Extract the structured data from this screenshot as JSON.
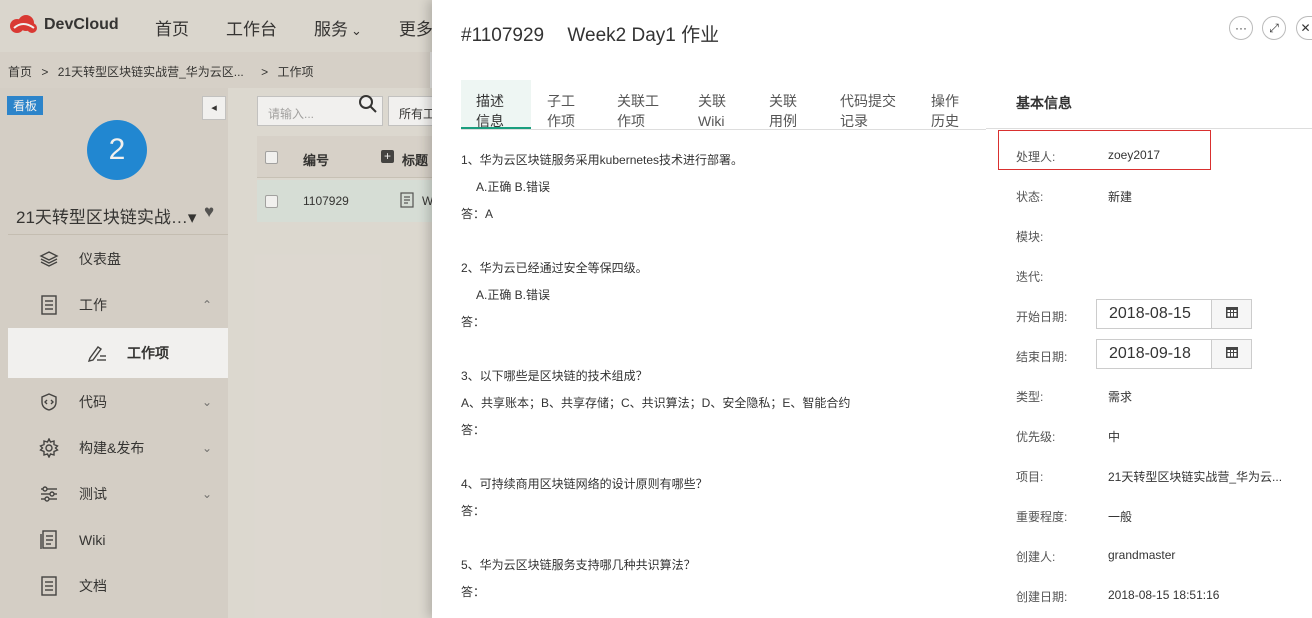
{
  "app": {
    "brand": "DevCloud",
    "brand_color": "#e53935",
    "top_nav": [
      "首页",
      "工作台",
      "服务",
      "更多"
    ],
    "dropdown_chevron": "⌄"
  },
  "breadcrumb": [
    "首页",
    ">",
    "21天转型区块链实战营_华为云区...",
    ">",
    "工作项"
  ],
  "sidebar": {
    "board_badge": "看板",
    "collapse_glyph": "◂",
    "project_number": "2",
    "project_name": "21天转型区块链实战…▾",
    "items": [
      {
        "label": "仪表盘",
        "icon": "layers-icon"
      },
      {
        "label": "工作",
        "icon": "list-doc-icon",
        "chevron": "⌃"
      },
      {
        "label": "工作项",
        "icon": "edit-list-icon"
      },
      {
        "label": "代码",
        "icon": "shield-code-icon",
        "chevron": "⌄"
      },
      {
        "label": "构建&发布",
        "icon": "gear-icon",
        "chevron": "⌄"
      },
      {
        "label": "测试",
        "icon": "sliders-icon",
        "chevron": "⌄"
      },
      {
        "label": "Wiki",
        "icon": "wiki-icon"
      },
      {
        "label": "文档",
        "icon": "doc-icon"
      }
    ]
  },
  "list": {
    "search_placeholder": "请输入...",
    "filter_label": "所有工",
    "columns": [
      "编号",
      "标题"
    ],
    "rows": [
      {
        "id": "1107929",
        "title": "W"
      }
    ]
  },
  "detail": {
    "id": "#1107929",
    "title": "Week2 Day1 作业",
    "actions": {
      "more": "···",
      "expand": "⤢",
      "close": "✕"
    },
    "tabs": [
      {
        "label_line1": "描述",
        "label_line2": "信息"
      },
      {
        "label_line1": "子工",
        "label_line2": "作项"
      },
      {
        "label_line1": "关联工",
        "label_line2": "作项"
      },
      {
        "label_line1": "关联",
        "label_line2": "Wiki"
      },
      {
        "label_line1": "关联",
        "label_line2": "用例"
      },
      {
        "label_line1": "代码提交",
        "label_line2": "记录"
      },
      {
        "label_line1": "操作",
        "label_line2": "历史"
      }
    ],
    "description": {
      "q1": "1、华为云区块链服务采用kubernetes技术进行部署。",
      "q1_opts": "A.正确   B.错误",
      "q1_ans": "答：A",
      "q2": "2、华为云已经通过安全等保四级。",
      "q2_opts": "A.正确   B.错误",
      "q2_ans": "答：",
      "q3": "3、以下哪些是区块链的技术组成？",
      "q3_opts": "A、共享账本；B、共享存储；C、共识算法；D、安全隐私；E、智能合约",
      "q3_ans": "答：",
      "q4": "4、可持续商用区块链网络的设计原则有哪些？",
      "q4_ans": "答：",
      "q5": "5、华为云区块链服务支持哪几种共识算法？",
      "q5_ans": "答："
    },
    "info": {
      "heading": "基本信息",
      "assignee_label": "处理人:",
      "assignee": "zoey2017",
      "status_label": "状态:",
      "status": "新建",
      "module_label": "模块:",
      "iteration_label": "迭代:",
      "start_label": "开始日期:",
      "start_date": "2018-08-15",
      "end_label": "结束日期:",
      "end_date": "2018-09-18",
      "type_label": "类型:",
      "type": "需求",
      "priority_label": "优先级:",
      "priority": "中",
      "project_label": "项目:",
      "project": "21天转型区块链实战营_华为云...",
      "severity_label": "重要程度:",
      "severity": "一般",
      "creator_label": "创建人:",
      "creator": "grandmaster",
      "created_label": "创建日期:",
      "created": "2018-08-15 18:51:16"
    },
    "highlight_color": "#d9302f"
  }
}
